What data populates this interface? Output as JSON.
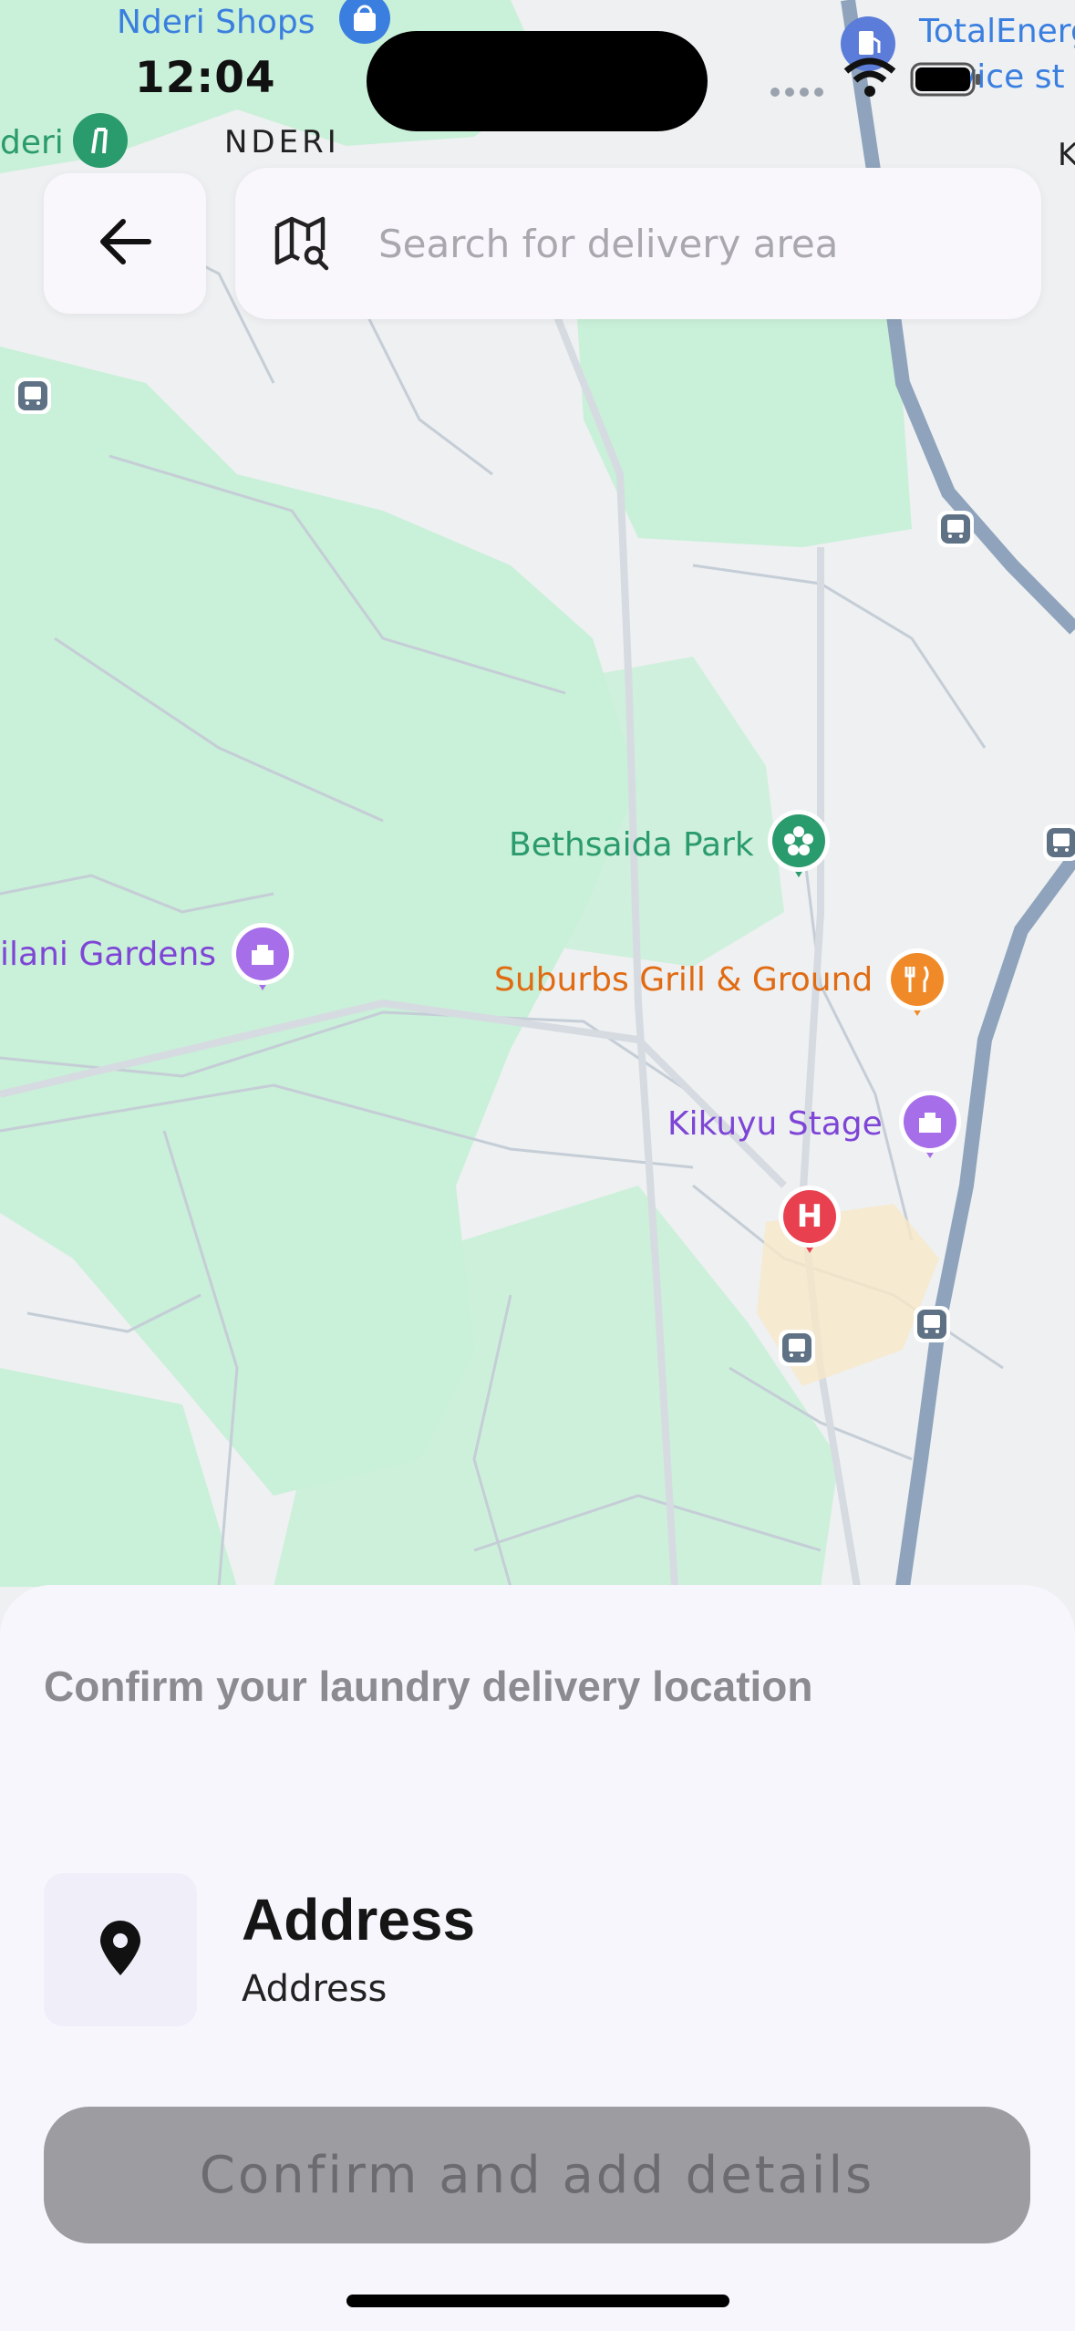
{
  "status_bar": {
    "time": "12:04"
  },
  "search": {
    "placeholder": "Search for delivery area"
  },
  "map": {
    "places": {
      "nderi_shops": "Nderi Shops",
      "total_energies": "TotalEnerg",
      "total_energies_line2": "vice st",
      "nderi_left": "deri",
      "nderi_area": "NDERI",
      "edge_k": "K",
      "bethsaida_park": "Bethsaida Park",
      "milani_gardens": "ilani Gardens",
      "suburbs_grill": "Suburbs Grill & Ground",
      "kikuyu_stage": "Kikuyu Stage",
      "hospital_letter": "H"
    },
    "colors": {
      "park": "#c9f0d8",
      "road_major": "#8fa4bc",
      "road_minor": "#c5cdd6",
      "poi_green": "#2a9b6c",
      "poi_purple": "#7e45d6",
      "poi_orange": "#e06b12",
      "poi_blue": "#3a7fe0",
      "hospital_red": "#e8404f"
    }
  },
  "sheet": {
    "title": "Confirm your laundry delivery location",
    "address_title": "Address",
    "address_subtitle": "Address",
    "confirm_label": "Confirm and add details"
  },
  "icons": {
    "back": "back-arrow-icon",
    "map_search": "map-search-icon",
    "location": "location-pin-icon"
  }
}
